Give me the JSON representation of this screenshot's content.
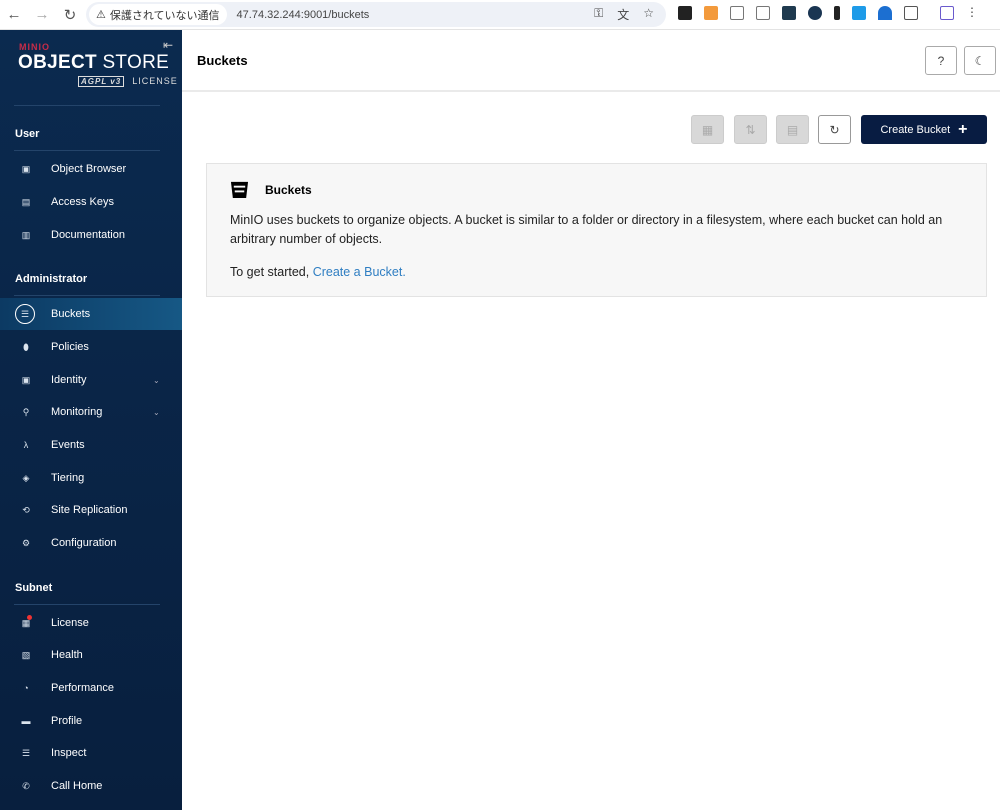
{
  "browser": {
    "security_label": "保護されていない通信",
    "url": "47.74.32.244:9001/buckets"
  },
  "logo": {
    "brand": "MINIO",
    "product_bold": "OBJECT",
    "product": " STORE",
    "license_badge": "AGPL v3",
    "license": "LICENSE"
  },
  "sidebar": {
    "groups": [
      {
        "label": "User",
        "items": [
          {
            "label": "Object Browser",
            "icon": "object-browser-icon",
            "g": "▣"
          },
          {
            "label": "Access Keys",
            "icon": "access-keys-icon",
            "g": "▤"
          },
          {
            "label": "Documentation",
            "icon": "documentation-icon",
            "g": "▥"
          }
        ]
      },
      {
        "label": "Administrator",
        "items": [
          {
            "label": "Buckets",
            "icon": "bucket-icon",
            "g": "☰",
            "active": true
          },
          {
            "label": "Policies",
            "icon": "policies-icon",
            "g": "⬮"
          },
          {
            "label": "Identity",
            "icon": "identity-icon",
            "g": "▣",
            "chevron": true
          },
          {
            "label": "Monitoring",
            "icon": "monitoring-icon",
            "g": "⚲",
            "chevron": true
          },
          {
            "label": "Events",
            "icon": "events-icon",
            "g": "λ"
          },
          {
            "label": "Tiering",
            "icon": "tiering-icon",
            "g": "◈"
          },
          {
            "label": "Site Replication",
            "icon": "site-replication-icon",
            "g": "⟲"
          },
          {
            "label": "Configuration",
            "icon": "configuration-icon",
            "g": "⚙"
          }
        ]
      },
      {
        "label": "Subnet",
        "items": [
          {
            "label": "License",
            "icon": "license-icon",
            "g": "▦",
            "dot": true
          },
          {
            "label": "Health",
            "icon": "health-icon",
            "g": "▧"
          },
          {
            "label": "Performance",
            "icon": "performance-icon",
            "g": "◔"
          },
          {
            "label": "Profile",
            "icon": "profile-icon",
            "g": "▬"
          },
          {
            "label": "Inspect",
            "icon": "inspect-icon",
            "g": "☰"
          },
          {
            "label": "Call Home",
            "icon": "call-home-icon",
            "g": "✆"
          }
        ]
      }
    ]
  },
  "header": {
    "title": "Buckets"
  },
  "toolbar": {
    "create_label": "Create Bucket"
  },
  "card": {
    "title": "Buckets",
    "text": "MinIO uses buckets to organize objects. A bucket is similar to a folder or directory in a filesystem, where each bucket can hold an arbitrary number of objects.",
    "start_prefix": "To get started, ",
    "start_link": "Create a Bucket."
  }
}
